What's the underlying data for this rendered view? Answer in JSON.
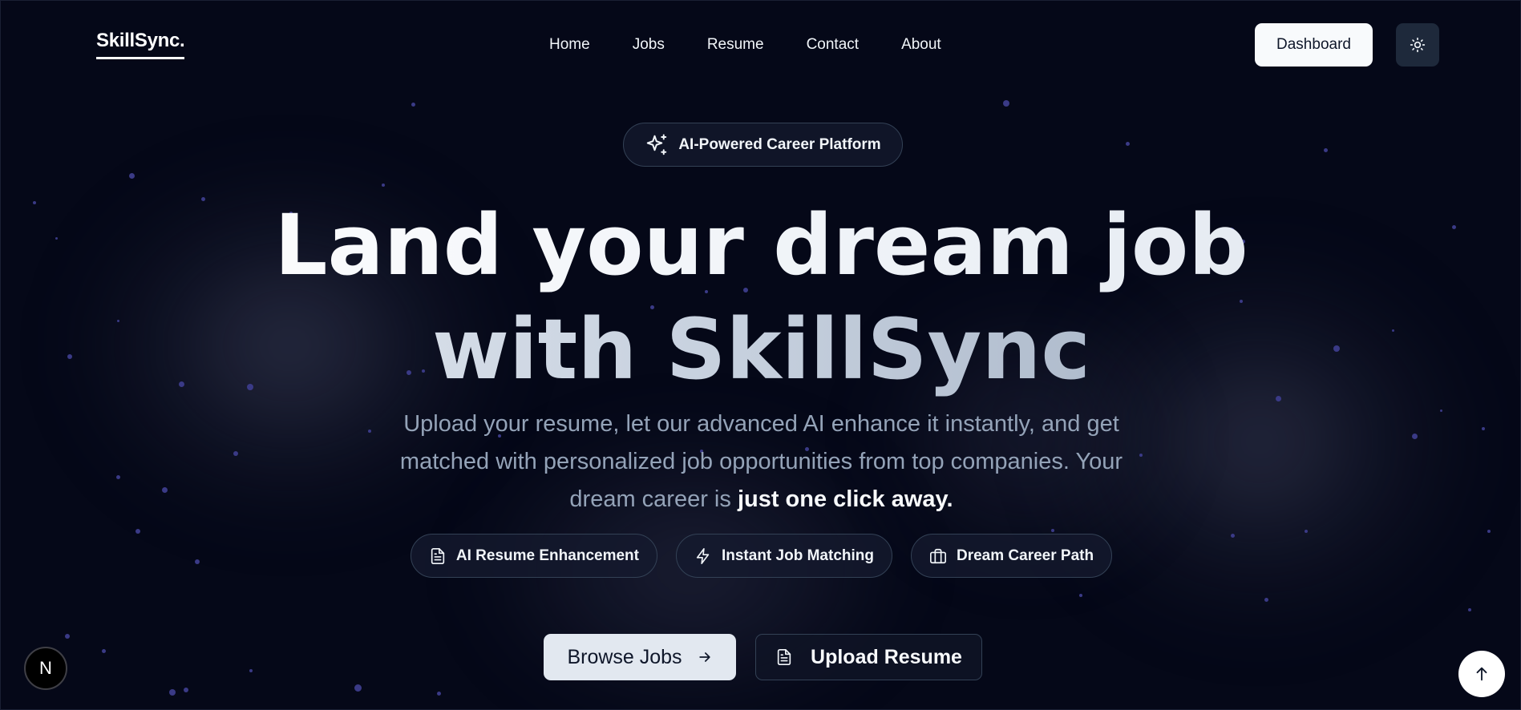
{
  "header": {
    "logo": "SkillSync.",
    "nav": [
      "Home",
      "Jobs",
      "Resume",
      "Contact",
      "About"
    ],
    "dashboard_label": "Dashboard",
    "theme_icon": "sun-icon"
  },
  "hero": {
    "badge_label": "AI-Powered Career Platform",
    "badge_icon": "sparkles-icon",
    "headline_line1": "Land your dream job",
    "headline_line2": "with SkillSync",
    "subtext_regular": "Upload your resume, let our advanced AI enhance it instantly, and get matched with personalized job opportunities from top companies. Your dream career is ",
    "subtext_bold": "just one click away.",
    "features": [
      {
        "label": "AI Resume Enhancement",
        "icon": "document-icon"
      },
      {
        "label": "Instant Job Matching",
        "icon": "zap-icon"
      },
      {
        "label": "Dream Career Path",
        "icon": "briefcase-icon"
      }
    ],
    "browse_label": "Browse Jobs",
    "upload_label": "Upload Resume"
  },
  "floating": {
    "n_badge": "N",
    "scroll_top_icon": "arrow-up-icon"
  },
  "colors": {
    "background": "#050818",
    "pill_border": "#334155",
    "muted_text": "#94a3b8",
    "light_button": "#e2e8f0"
  }
}
